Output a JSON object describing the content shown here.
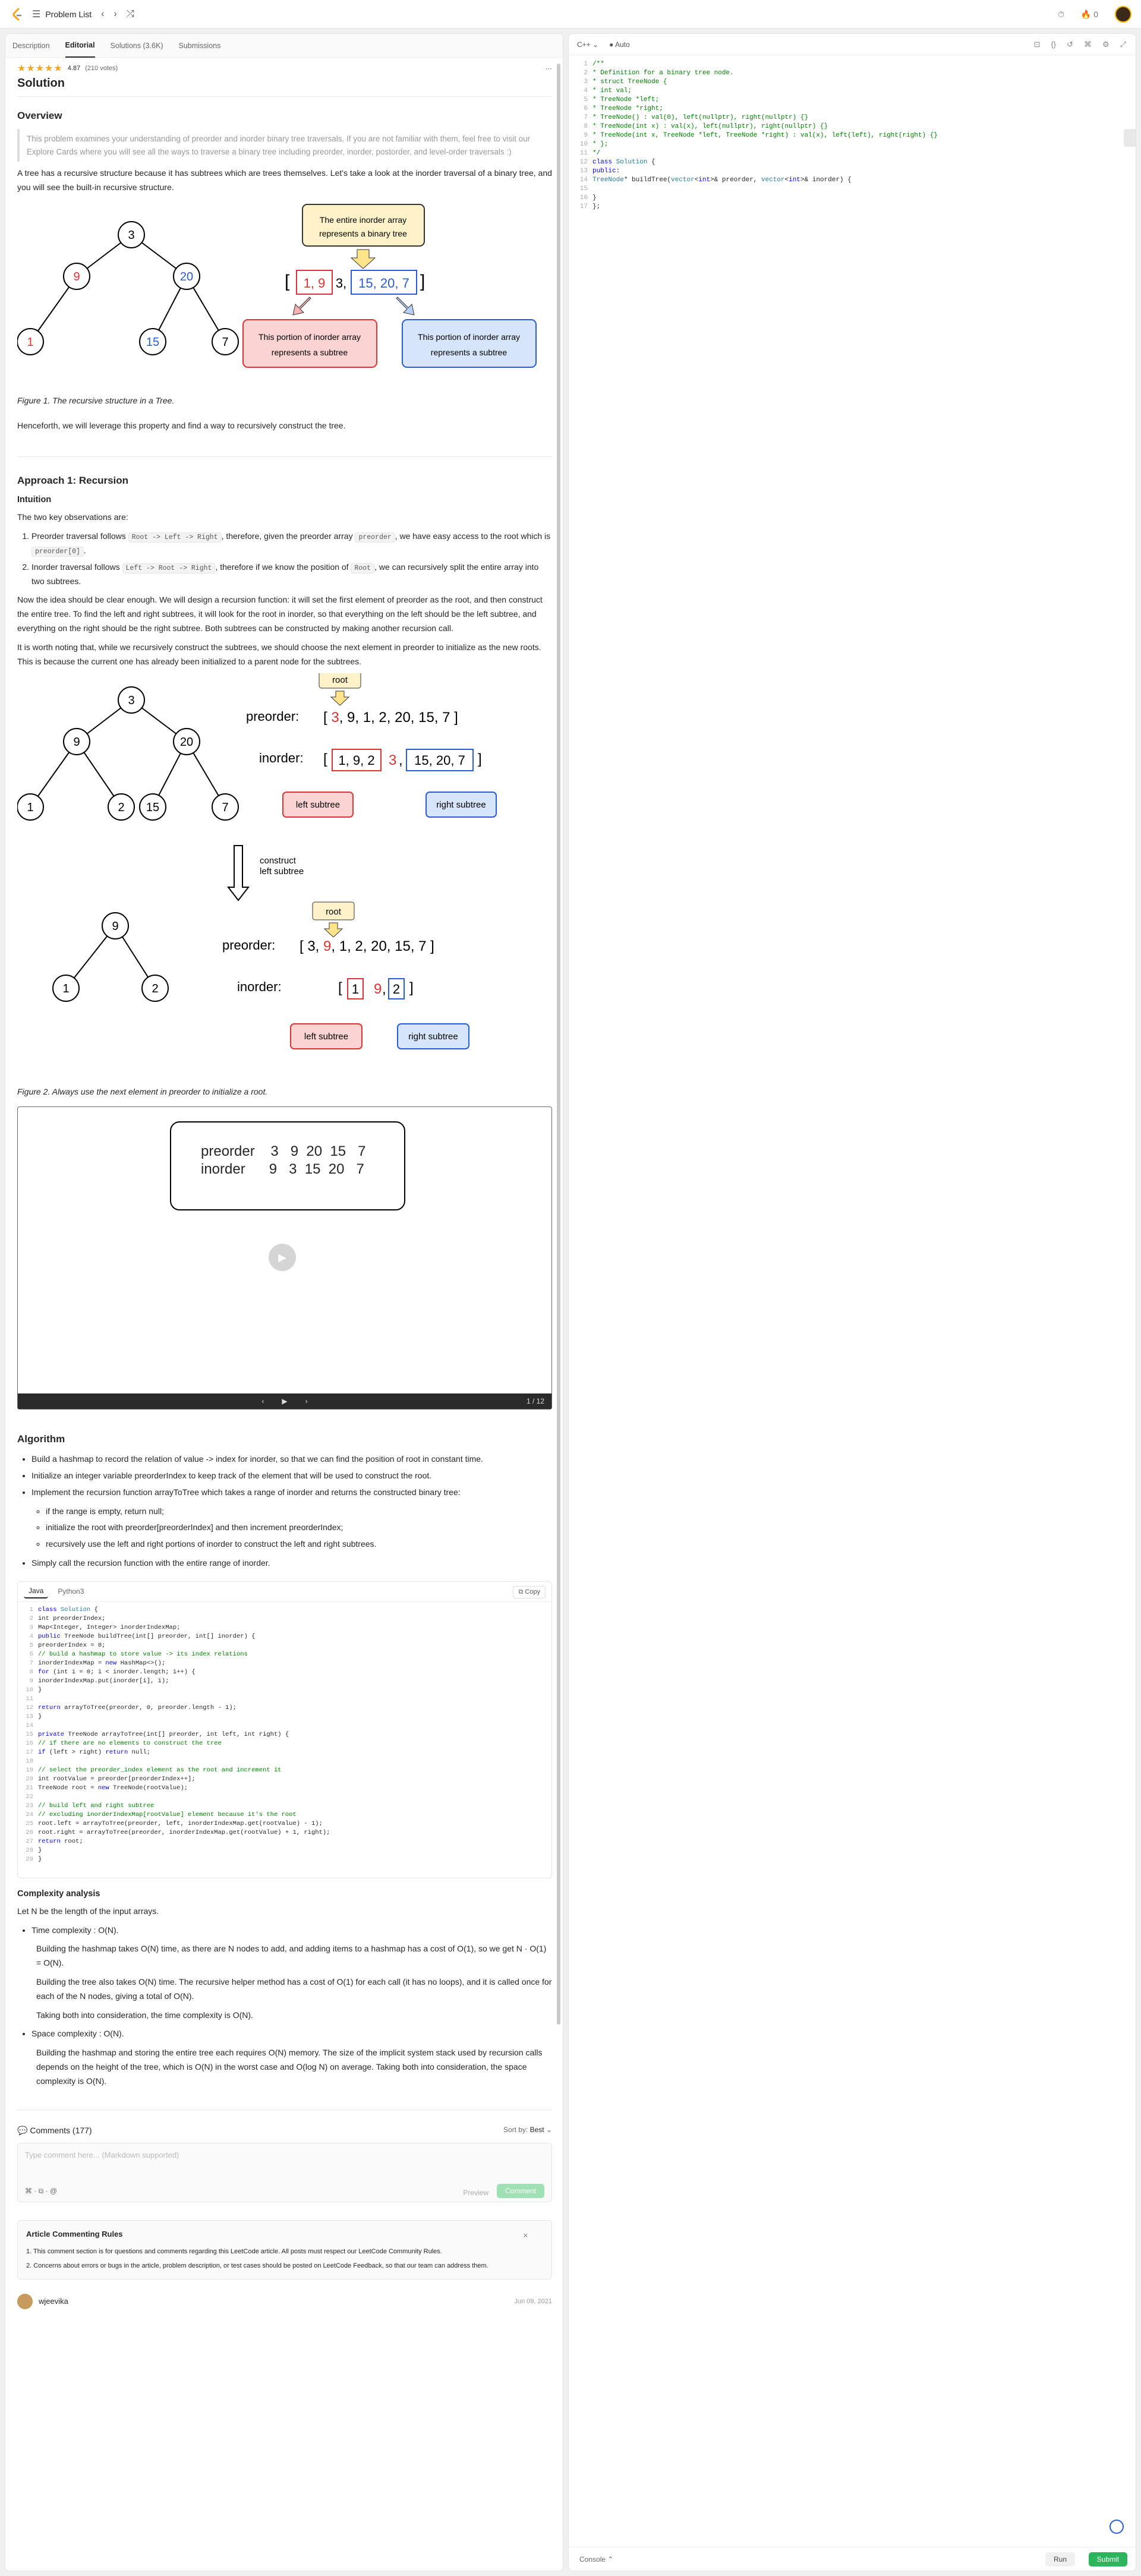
{
  "topbar": {
    "title": "Problem List",
    "badge_count": "0"
  },
  "tabs": [
    "Description",
    "Editorial",
    "Solutions (3.6K)",
    "Submissions"
  ],
  "rating": {
    "stars": "★★★★★",
    "score": "4.87",
    "votes": "(210 votes)"
  },
  "solution": {
    "title": "Solution",
    "overview_h": "Overview",
    "quote": "This problem examines your understanding of preorder and inorder binary tree traversals. If you are not familiar with them, feel free to visit our Explore Cards where you will see all the ways to traverse a binary tree including preorder, inorder, postorder, and level-order traversals :)",
    "p1": "A tree has a recursive structure because it has subtrees which are trees themselves. Let's take a look at the inorder traversal of a binary tree, and you will see the built-in recursive structure.",
    "fig1_cap": "Figure 1. The recursive structure in a Tree.",
    "fig1": {
      "callout": "The entire inorder array represents a binary tree",
      "left": "This portion of inorder array represents a subtree",
      "right": "This portion of inorder array represents a subtree",
      "arr_l": "1, 9",
      "arr_m": "3,",
      "arr_r": "15, 20, 7"
    },
    "p2": "Henceforth, we will leverage this property and find a way to recursively construct the tree.",
    "approach_h": "Approach 1: Recursion",
    "intuition_h": "Intuition",
    "p3": "The two key observations are:",
    "obs1a": "Preorder traversal follows ",
    "obs1code": "Root -> Left -> Right",
    "obs1b": ", therefore, given the preorder array ",
    "obs1code2": "preorder",
    "obs1c": ", we have easy access to the root which is ",
    "obs1code3": "preorder[0]",
    "obs1d": ".",
    "obs2a": "Inorder traversal follows ",
    "obs2code": "Left -> Root -> Right",
    "obs2b": ", therefore if we know the position of ",
    "obs2code2": "Root",
    "obs2c": ", we can recursively split the entire array into two subtrees.",
    "p4": "Now the idea should be clear enough. We will design a recursion function: it will set the first element of preorder as the root, and then construct the entire tree. To find the left and right subtrees, it will look for the root in inorder, so that everything on the left should be the left subtree, and everything on the right should be the right subtree. Both subtrees can be constructed by making another recursion call.",
    "p5": "It is worth noting that, while we recursively construct the subtrees, we should choose the next element in preorder to initialize as the new roots. This is because the current one has already been initialized to a parent node for the subtrees.",
    "fig2_cap": "Figure 2. Always use the next element in preorder to initialize a root.",
    "fig2": {
      "root": "root",
      "preorder": "preorder:",
      "inorder": "inorder:",
      "left": "left subtree",
      "right": "right subtree",
      "construct": "construct",
      "construct2": "left subtree"
    },
    "slide": {
      "row1": "preorder    3   9  20  15   7",
      "row2": "inorder      9   3  15  20   7",
      "count": "1 / 12"
    },
    "algo_h": "Algorithm",
    "algo": [
      "Build a hashmap to record the relation of value -> index for inorder, so that we can find the position of root in constant time.",
      "Initialize an integer variable preorderIndex to keep track of the element that will be used to construct the root.",
      "Implement the recursion function arrayToTree which takes a range of inorder and returns the constructed binary tree:",
      "Simply call the recursion function with the entire range of inorder."
    ],
    "algo_sub": [
      "if the range is empty, return null;",
      "initialize the root with preorder[preorderIndex] and then increment preorderIndex;",
      "recursively use the left and right portions of inorder to construct the left and right subtrees."
    ],
    "code_tabs": [
      "Java",
      "Python3"
    ],
    "copy": "Copy",
    "complexity_h": "Complexity analysis",
    "c1": "Let N be the length of the input arrays.",
    "c2": "Time complexity : O(N).",
    "c3": "Building the hashmap takes O(N) time, as there are N nodes to add, and adding items to a hashmap has a cost of O(1), so we get N · O(1) = O(N).",
    "c4": "Building the tree also takes O(N) time. The recursive helper method has a cost of O(1) for each call (it has no loops), and it is called once for each of the N nodes, giving a total of O(N).",
    "c5": "Taking both into consideration, the time complexity is O(N).",
    "c6": "Space complexity : O(N).",
    "c7": "Building the hashmap and storing the entire tree each requires O(N) memory. The size of the implicit system stack used by recursion calls depends on the height of the tree, which is O(N) in the worst case and O(log N) on average. Taking both into consideration, the space complexity is O(N)."
  },
  "comments": {
    "title": "Comments (177)",
    "sort": "Sort by:",
    "sort_val": "Best",
    "placeholder": "Type comment here... (Markdown supported)",
    "preview": "Preview",
    "comment": "Comment",
    "rules_title": "Article Commenting Rules",
    "rule1": "1. This comment section is for questions and comments regarding this LeetCode article. All posts must respect our LeetCode Community Rules.",
    "rule2": "2. Concerns about errors or bugs in the article, problem description, or test cases should be posted on LeetCode Feedback, so that our team can address them.",
    "user": "wjeevika",
    "date": "Jun 09, 2021"
  },
  "editor": {
    "lang": "C++",
    "mode": "Auto",
    "console": "Console",
    "run": "Run",
    "submit": "Submit"
  }
}
